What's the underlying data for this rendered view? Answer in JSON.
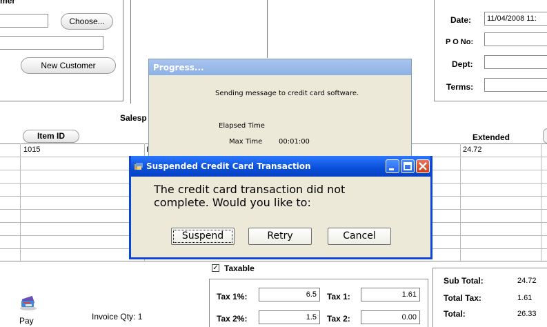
{
  "customer": {
    "label_fragment": "mer",
    "choose_button": "Choose...",
    "new_customer_button": "New Customer"
  },
  "header": {
    "date_label": "Date:",
    "date_value": "11/04/2008 11:",
    "po_label": "P O No:",
    "dept_label": "Dept:",
    "terms_label": "Terms:"
  },
  "salesperson_fragment": "Salesp",
  "grid": {
    "item_id_header": "Item ID",
    "extended_header": "Extended",
    "rows": [
      {
        "item_id": "1015",
        "desc_fragment": "I",
        "extended": "24.72"
      }
    ]
  },
  "progress_dialog": {
    "title": "Progress...",
    "message": "Sending message to credit card software.",
    "elapsed_label": "Elapsed Time",
    "max_label": "Max Time",
    "max_value": "00:01:00"
  },
  "suspended_dialog": {
    "title": "Suspended Credit Card Transaction",
    "message_line1": "The credit card transaction did not",
    "message_line2": "complete. Would you like to:",
    "suspend_button": "Suspend",
    "retry_button": "Retry",
    "cancel_button": "Cancel"
  },
  "footer": {
    "taxable_label": "Taxable",
    "tax1pct_label": "Tax 1%:",
    "tax1pct_value": "6.5",
    "tax1_label": "Tax 1:",
    "tax1_value": "1.61",
    "tax2pct_label": "Tax 2%:",
    "tax2pct_value": "1.5",
    "tax2_label": "Tax 2:",
    "tax2_value": "0.00",
    "invoice_qty": "Invoice Qty: 1",
    "pay_label": "Pay",
    "subtotal_label": "Sub Total:",
    "subtotal_value": "24.72",
    "totaltax_label": "Total Tax:",
    "totaltax_value": "1.61",
    "total_label": "Total:",
    "total_value": "26.33"
  },
  "colors": {
    "xp_title_blue": "#0a4fd8",
    "xp_dialog_bg": "#ece9d8",
    "progress_title": "#8db1e5"
  }
}
